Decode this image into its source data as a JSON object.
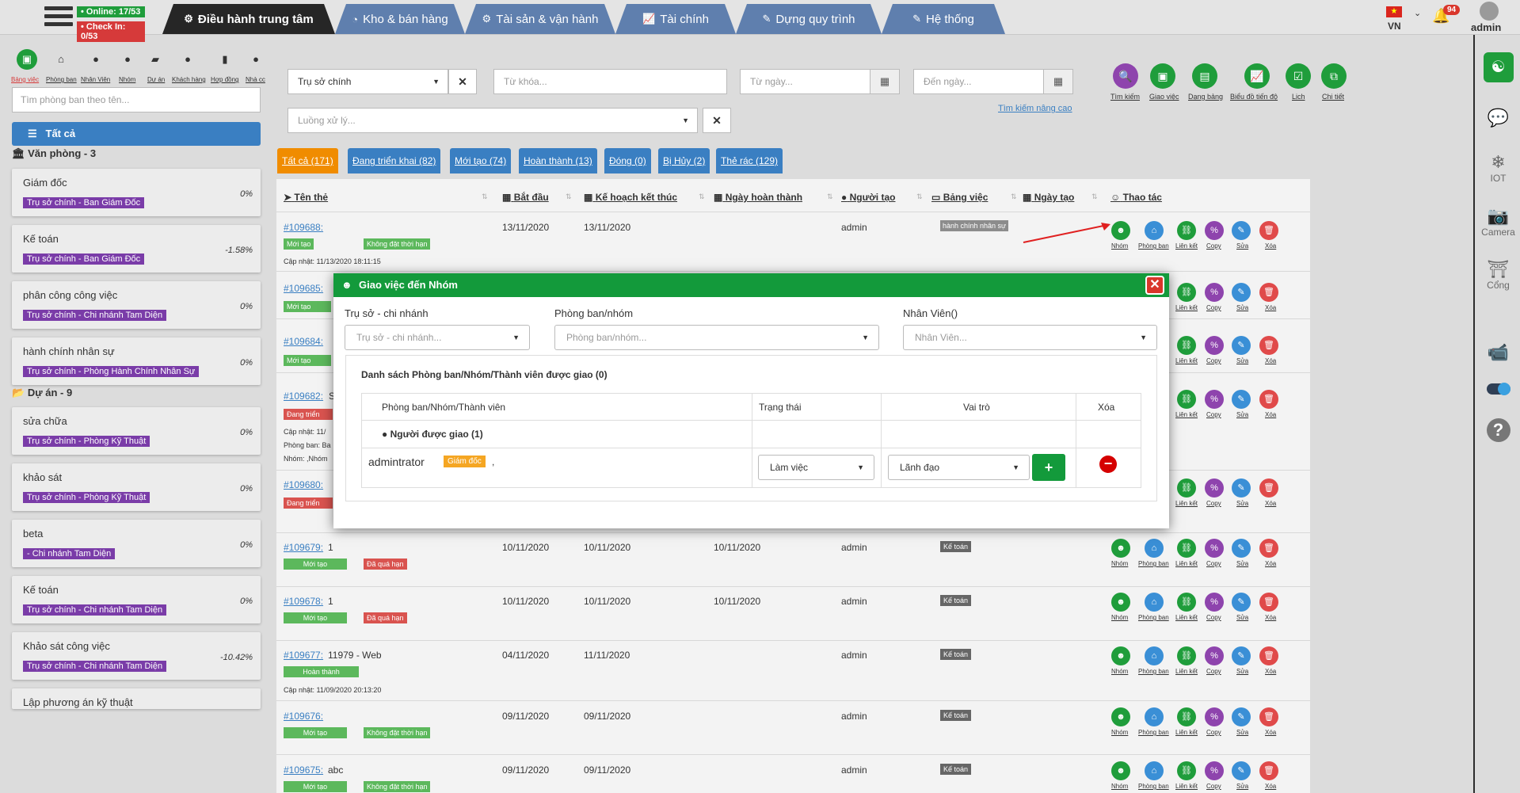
{
  "topbar": {
    "online": "• Online: 17/53",
    "checkin": "• Check In: 0/53",
    "tabs": [
      "Điều hành trung tâm",
      "Kho & bán hàng",
      "Tài sản & vận hành",
      "Tài chính",
      "Dựng quy trình",
      "Hệ thống"
    ],
    "lang": "VN",
    "notif_count": "94",
    "user": "admin"
  },
  "sidebar": {
    "icons": [
      "Bảng việc",
      "Phòng ban",
      "Nhân Viên",
      "Nhóm",
      "Dự án",
      "Khách hàng",
      "Hợp đồng",
      "Nhà cc"
    ],
    "search_placeholder": "Tìm phòng ban theo tên...",
    "all_label": "Tất cả",
    "group_office": "Văn phòng - 3",
    "group_project": "Dự án - 9",
    "cards": [
      {
        "title": "Giám đốc",
        "tag": "Trụ sở chính - Ban Giám Đốc",
        "pct": "0%"
      },
      {
        "title": "Kế toán",
        "tag": "Trụ sở chính - Ban Giám Đốc",
        "pct": "-1.58%"
      },
      {
        "title": "phân công công việc",
        "tag": "Trụ sở chính - Chi nhánh Tam Diện",
        "pct": "0%"
      },
      {
        "title": "hành chính nhân sự",
        "tag": "Trụ sở chính - Phòng Hành Chính Nhân Sự",
        "pct": "0%"
      }
    ],
    "project_cards": [
      {
        "title": "sửa chữa",
        "tag": "Trụ sở chính - Phòng Kỹ Thuật",
        "pct": "0%"
      },
      {
        "title": "khảo sát",
        "tag": "Trụ sở chính - Phòng Kỹ Thuật",
        "pct": "0%"
      },
      {
        "title": "beta",
        "tag": "- Chi nhánh Tam Diện",
        "pct": "0%"
      },
      {
        "title": "Kế toán",
        "tag": "Trụ sở chính - Chi nhánh Tam Diện",
        "pct": "0%"
      },
      {
        "title": "Khảo sát công việc",
        "tag": "Trụ sở chính - Chi nhánh Tam Diện",
        "pct": "-10.42%"
      },
      {
        "title": "Lập phương án kỹ thuật"
      }
    ]
  },
  "filters": {
    "branch": "Trụ sở chính",
    "keyword_placeholder": "Từ khóa...",
    "from_placeholder": "Từ ngày...",
    "to_placeholder": "Đến ngày...",
    "flow_placeholder": "Luồng xử lý...",
    "advanced": "Tìm kiếm nâng cao"
  },
  "tools": [
    "Tìm kiếm",
    "Giao việc",
    "Dạng bảng",
    "Biểu đồ tiến độ",
    "Lịch",
    "Chi tiết"
  ],
  "status_tabs": [
    "Tất cả (171)",
    "Đang triển khai (82)",
    "Mới tạo (74)",
    "Hoàn thành (13)",
    "Đóng (0)",
    "Bị Hủy (2)",
    "Thẻ rác (129)"
  ],
  "table": {
    "headers": [
      "Tên thẻ",
      "Bắt đầu",
      "Kế hoạch kết thúc",
      "Ngày hoàn thành",
      "Người tạo",
      "Bảng việc",
      "Ngày tạo",
      "Thao tác"
    ],
    "actions": [
      "Nhóm",
      "Phòng ban",
      "Liên kết",
      "Copy",
      "Sửa",
      "Xóa"
    ],
    "rows": [
      {
        "id": "#109688:",
        "name": "",
        "start": "13/11/2020",
        "plan": "13/11/2020",
        "done": "",
        "creator": "admin",
        "board": "hành chính nhân sự",
        "labels": [
          "Mới tạo",
          "Không đặt thời hạn"
        ],
        "updated": "Cập nhật: 11/13/2020 18:11:15"
      },
      {
        "id": "#109685:",
        "labels": [
          "Mới tạo"
        ]
      },
      {
        "id": "#109684:",
        "labels": [
          "Mới tạo"
        ]
      },
      {
        "id": "#109682:",
        "name": "S",
        "labels": [
          "Đang triển"
        ],
        "updated": "Cập nhật: 11/",
        "extra1": "Phòng ban: Ba",
        "extra2": "Nhóm: ,Nhóm"
      },
      {
        "id": "#109680:",
        "labels": [
          "Đang triển"
        ]
      },
      {
        "id": "#109679:",
        "name": "1",
        "start": "10/11/2020",
        "plan": "10/11/2020",
        "done": "10/11/2020",
        "creator": "admin",
        "board": "Kế toán",
        "labels": [
          "Mới tạo",
          "Đã quá hạn"
        ]
      },
      {
        "id": "#109678:",
        "name": "1",
        "start": "10/11/2020",
        "plan": "10/11/2020",
        "done": "10/11/2020",
        "creator": "admin",
        "board": "Kế toán",
        "labels": [
          "Mới tạo",
          "Đã quá hạn"
        ]
      },
      {
        "id": "#109677:",
        "name": "11979 - Web",
        "start": "04/11/2020",
        "plan": "11/11/2020",
        "done": "",
        "creator": "admin",
        "board": "Kế toán",
        "labels": [
          "Hoàn thành"
        ],
        "updated": "Cập nhật: 11/09/2020 20:13:20"
      },
      {
        "id": "#109676:",
        "name": "",
        "start": "09/11/2020",
        "plan": "09/11/2020",
        "done": "",
        "creator": "admin",
        "board": "Kế toán",
        "labels": [
          "Mới tạo",
          "Không đặt thời hạn"
        ]
      },
      {
        "id": "#109675:",
        "name": "abc",
        "start": "09/11/2020",
        "plan": "09/11/2020",
        "done": "",
        "creator": "admin",
        "board": "Kế toán",
        "labels": [
          "Mới tạo",
          "Không đặt thời hạn"
        ]
      }
    ]
  },
  "modal": {
    "title": "Giao việc đến Nhóm",
    "branch_label": "Trụ sở - chi nhánh",
    "branch_placeholder": "Trụ sở - chi nhánh...",
    "dept_label": "Phòng ban/nhóm",
    "dept_placeholder": "Phòng ban/nhóm...",
    "staff_label": "Nhân Viên()",
    "staff_placeholder": "Nhân Viên...",
    "list_title": "Danh sách Phòng ban/Nhóm/Thành viên được giao (0)",
    "col_member": "Phòng ban/Nhóm/Thành viên",
    "col_status": "Trạng thái",
    "col_role": "Vai trò",
    "col_delete": "Xóa",
    "assigned": "Người được giao (1)",
    "member_name": "admintrator",
    "member_badge": "Giám đốc",
    "member_sep": ",",
    "status_value": "Làm việc",
    "role_value": "Lãnh đạo"
  },
  "rail": [
    "IOT",
    "Camera",
    "Cổng"
  ]
}
